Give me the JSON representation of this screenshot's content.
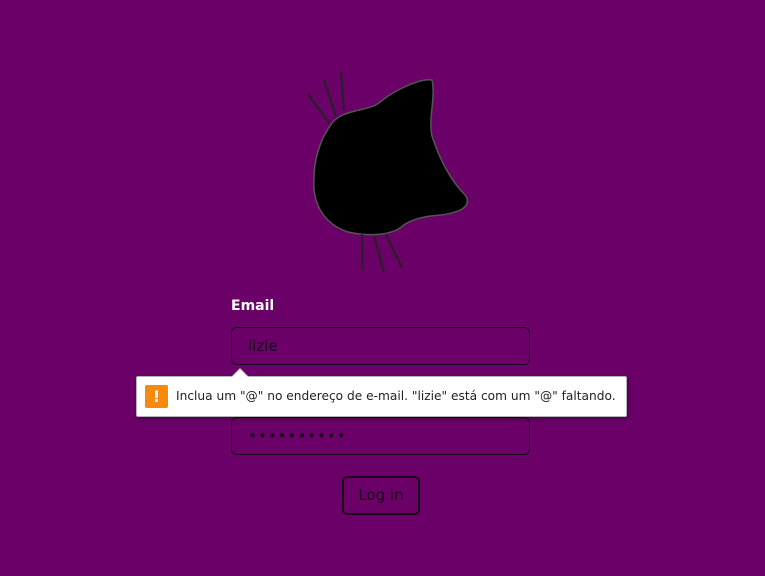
{
  "form": {
    "email_label": "Email",
    "email_value": "lizie",
    "password_value": "••••••••••",
    "login_label": "Log in"
  },
  "validation_tooltip": {
    "icon": "warning-icon",
    "icon_glyph": "!",
    "message": "Inclua um \"@\" no endereço de e-mail. \"lizie\" está com um \"@\" faltando."
  },
  "colors": {
    "background": "#6b0069",
    "label": "#ffffff",
    "field_border": "#1a001a",
    "warning": "#f7890c"
  },
  "logo": {
    "icon": "cat-head-icon"
  }
}
